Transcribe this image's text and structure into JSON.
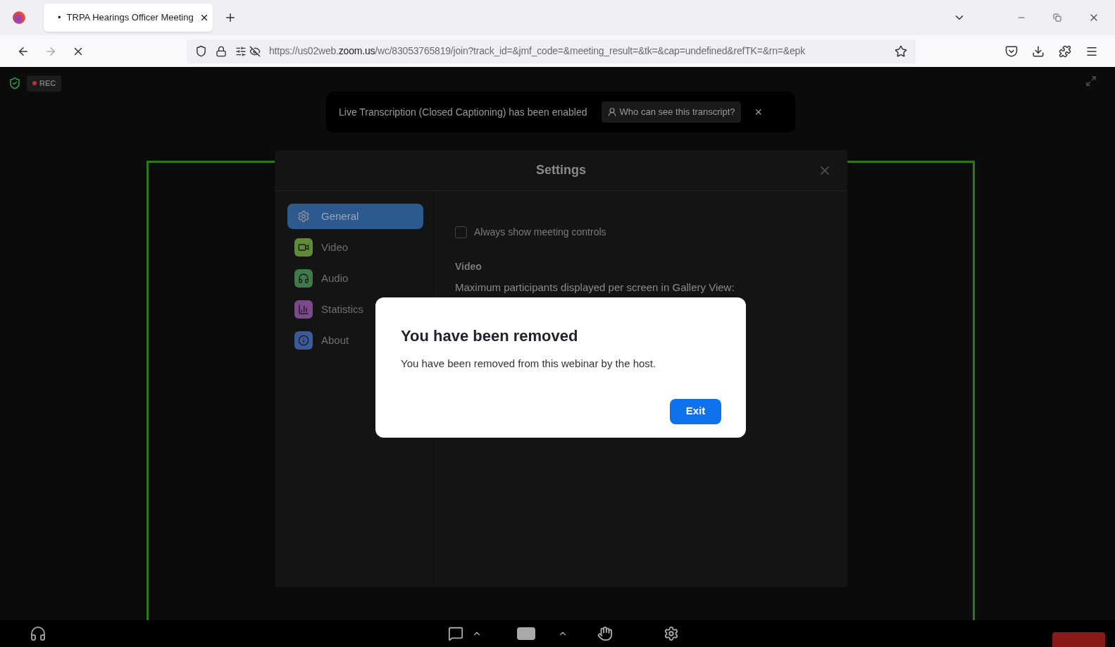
{
  "browser": {
    "tabs": [
      {
        "bullet": "•",
        "title": "TRPA Hearings Officer Meeting",
        "selected": true
      }
    ],
    "url_prefix": "https://us02web.",
    "url_domain": "zoom.us",
    "url_rest": "/wc/83053765819/join?track_id=&jmf_code=&meeting_result=&tk=&cap=undefined&refTK=&rn=&epk"
  },
  "meeting": {
    "rec_label": "REC",
    "banner": {
      "text": "Live Transcription (Closed Captioning) has been enabled",
      "link": "Who can see this transcript?",
      "close": "×"
    }
  },
  "settings": {
    "title": "Settings",
    "nav": [
      {
        "label": "General",
        "kind": "gear",
        "color": "#8a8f99",
        "selected": true
      },
      {
        "label": "Video",
        "kind": "video",
        "color": "#5f8a3a",
        "selected": false
      },
      {
        "label": "Audio",
        "kind": "audio",
        "color": "#3f7a4a",
        "selected": false
      },
      {
        "label": "Statistics",
        "kind": "stats",
        "color": "#7a4a8a",
        "selected": false
      },
      {
        "label": "About",
        "kind": "info",
        "color": "#3a5a9a",
        "selected": false
      }
    ],
    "always_show_controls": {
      "label": "Always show meeting controls",
      "checked": false
    },
    "video_heading": "Video",
    "gallery_label": "Maximum participants displayed per screen in Gallery View:"
  },
  "dialog": {
    "title": "You have been removed",
    "message": "You have been removed from this webinar by the host.",
    "button": "Exit"
  }
}
